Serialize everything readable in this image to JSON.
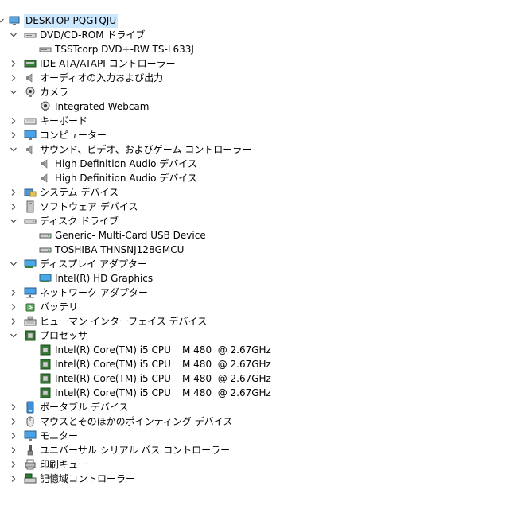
{
  "tree": {
    "root": "DESKTOP-PQGTQJU",
    "nodes": [
      {
        "label": "DVD/CD-ROM ドライブ",
        "expanded": true,
        "icon": "dvd-drive-icon",
        "children": [
          {
            "label": "TSSTcorp DVD+-RW TS-L633J",
            "icon": "dvd-drive-icon"
          }
        ]
      },
      {
        "label": "IDE ATA/ATAPI コントローラー",
        "expanded": false,
        "icon": "ide-controller-icon",
        "children": []
      },
      {
        "label": "オーディオの入力および出力",
        "expanded": false,
        "icon": "speaker-icon",
        "children": []
      },
      {
        "label": "カメラ",
        "expanded": true,
        "icon": "webcam-icon",
        "children": [
          {
            "label": "Integrated Webcam",
            "icon": "webcam-icon"
          }
        ]
      },
      {
        "label": "キーボード",
        "expanded": false,
        "icon": "keyboard-icon",
        "children": []
      },
      {
        "label": "コンピューター",
        "expanded": false,
        "icon": "monitor-icon",
        "children": []
      },
      {
        "label": "サウンド、ビデオ、およびゲーム コントローラー",
        "expanded": true,
        "icon": "speaker-icon",
        "children": [
          {
            "label": "High Definition Audio デバイス",
            "icon": "speaker-icon"
          },
          {
            "label": "High Definition Audio デバイス",
            "icon": "speaker-icon"
          }
        ]
      },
      {
        "label": "システム デバイス",
        "expanded": false,
        "icon": "system-folder-icon",
        "children": []
      },
      {
        "label": "ソフトウェア デバイス",
        "expanded": false,
        "icon": "software-device-icon",
        "children": []
      },
      {
        "label": "ディスク ドライブ",
        "expanded": true,
        "icon": "disk-drive-icon",
        "children": [
          {
            "label": "Generic- Multi-Card USB Device",
            "icon": "disk-drive-icon"
          },
          {
            "label": "TOSHIBA THNSNJ128GMCU",
            "icon": "disk-drive-icon"
          }
        ]
      },
      {
        "label": "ディスプレイ アダプター",
        "expanded": true,
        "icon": "display-adapter-icon",
        "children": [
          {
            "label": "Intel(R) HD Graphics",
            "icon": "display-adapter-icon"
          }
        ]
      },
      {
        "label": "ネットワーク アダプター",
        "expanded": false,
        "icon": "network-icon",
        "children": []
      },
      {
        "label": "バッテリ",
        "expanded": false,
        "icon": "battery-icon",
        "children": []
      },
      {
        "label": "ヒューマン インターフェイス デバイス",
        "expanded": false,
        "icon": "hid-icon",
        "children": []
      },
      {
        "label": "プロセッサ",
        "expanded": true,
        "icon": "processor-icon",
        "children": [
          {
            "label": "Intel(R) Core(TM) i5 CPU",
            "suffix": "M 480  @ 2.67GHz",
            "icon": "processor-icon"
          },
          {
            "label": "Intel(R) Core(TM) i5 CPU",
            "suffix": "M 480  @ 2.67GHz",
            "icon": "processor-icon"
          },
          {
            "label": "Intel(R) Core(TM) i5 CPU",
            "suffix": "M 480  @ 2.67GHz",
            "icon": "processor-icon"
          },
          {
            "label": "Intel(R) Core(TM) i5 CPU",
            "suffix": "M 480  @ 2.67GHz",
            "icon": "processor-icon"
          }
        ]
      },
      {
        "label": "ポータブル デバイス",
        "expanded": false,
        "icon": "portable-device-icon",
        "children": []
      },
      {
        "label": "マウスとそのほかのポインティング デバイス",
        "expanded": false,
        "icon": "mouse-icon",
        "children": []
      },
      {
        "label": "モニター",
        "expanded": false,
        "icon": "monitor-icon",
        "children": []
      },
      {
        "label": "ユニバーサル シリアル バス コントローラー",
        "expanded": false,
        "icon": "usb-icon",
        "children": []
      },
      {
        "label": "印刷キュー",
        "expanded": false,
        "icon": "printer-icon",
        "children": []
      },
      {
        "label": "記憶域コントローラー",
        "expanded": false,
        "icon": "storage-controller-icon",
        "children": []
      }
    ]
  }
}
